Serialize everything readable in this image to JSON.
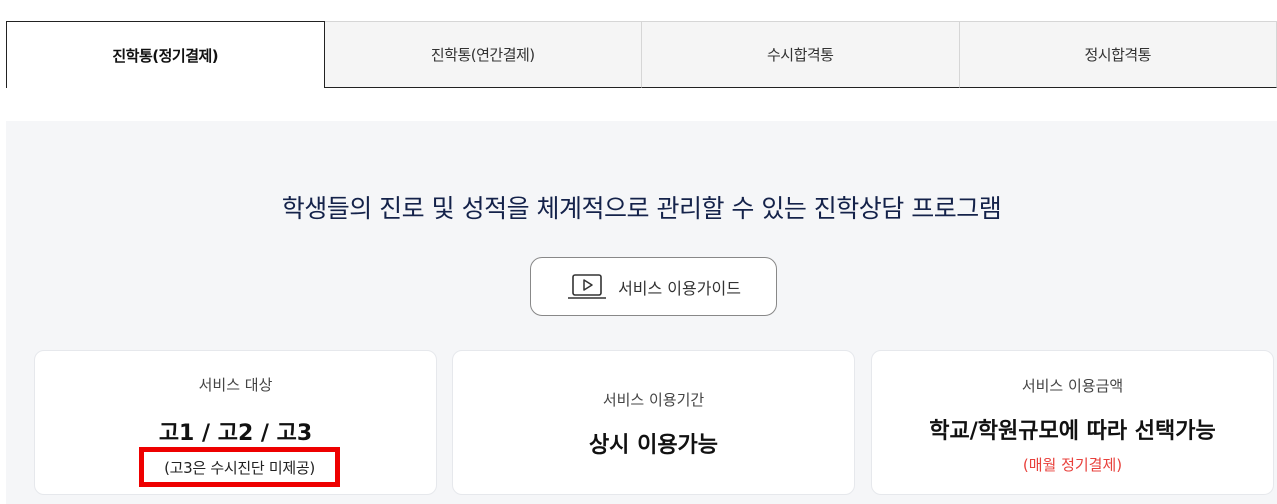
{
  "tabs": [
    {
      "label": "진학통(정기결제)",
      "active": true
    },
    {
      "label": "진학통(연간결제)",
      "active": false
    },
    {
      "label": "수시합격통",
      "active": false
    },
    {
      "label": "정시합격통",
      "active": false
    }
  ],
  "main": {
    "headline": "학생들의 진로 및 성적을 체계적으로 관리할 수 있는 진학상담 프로그램",
    "guide_button": {
      "label": "서비스 이용가이드",
      "icon": "video-play-icon"
    }
  },
  "cards": [
    {
      "label": "서비스 대상",
      "value": "고1 / 고2 / 고3",
      "note": "(고3은 수시진단 미제공)"
    },
    {
      "label": "서비스 이용기간",
      "value": "상시 이용가능"
    },
    {
      "label": "서비스 이용금액",
      "value": "학교/학원규모에 따라 선택가능",
      "sub": "(매월 정기결제)"
    }
  ],
  "colors": {
    "headline": "#14224a",
    "highlight_border": "#ee0000",
    "payment_note": "#e8413c",
    "panel_background": "#f5f6f8"
  }
}
